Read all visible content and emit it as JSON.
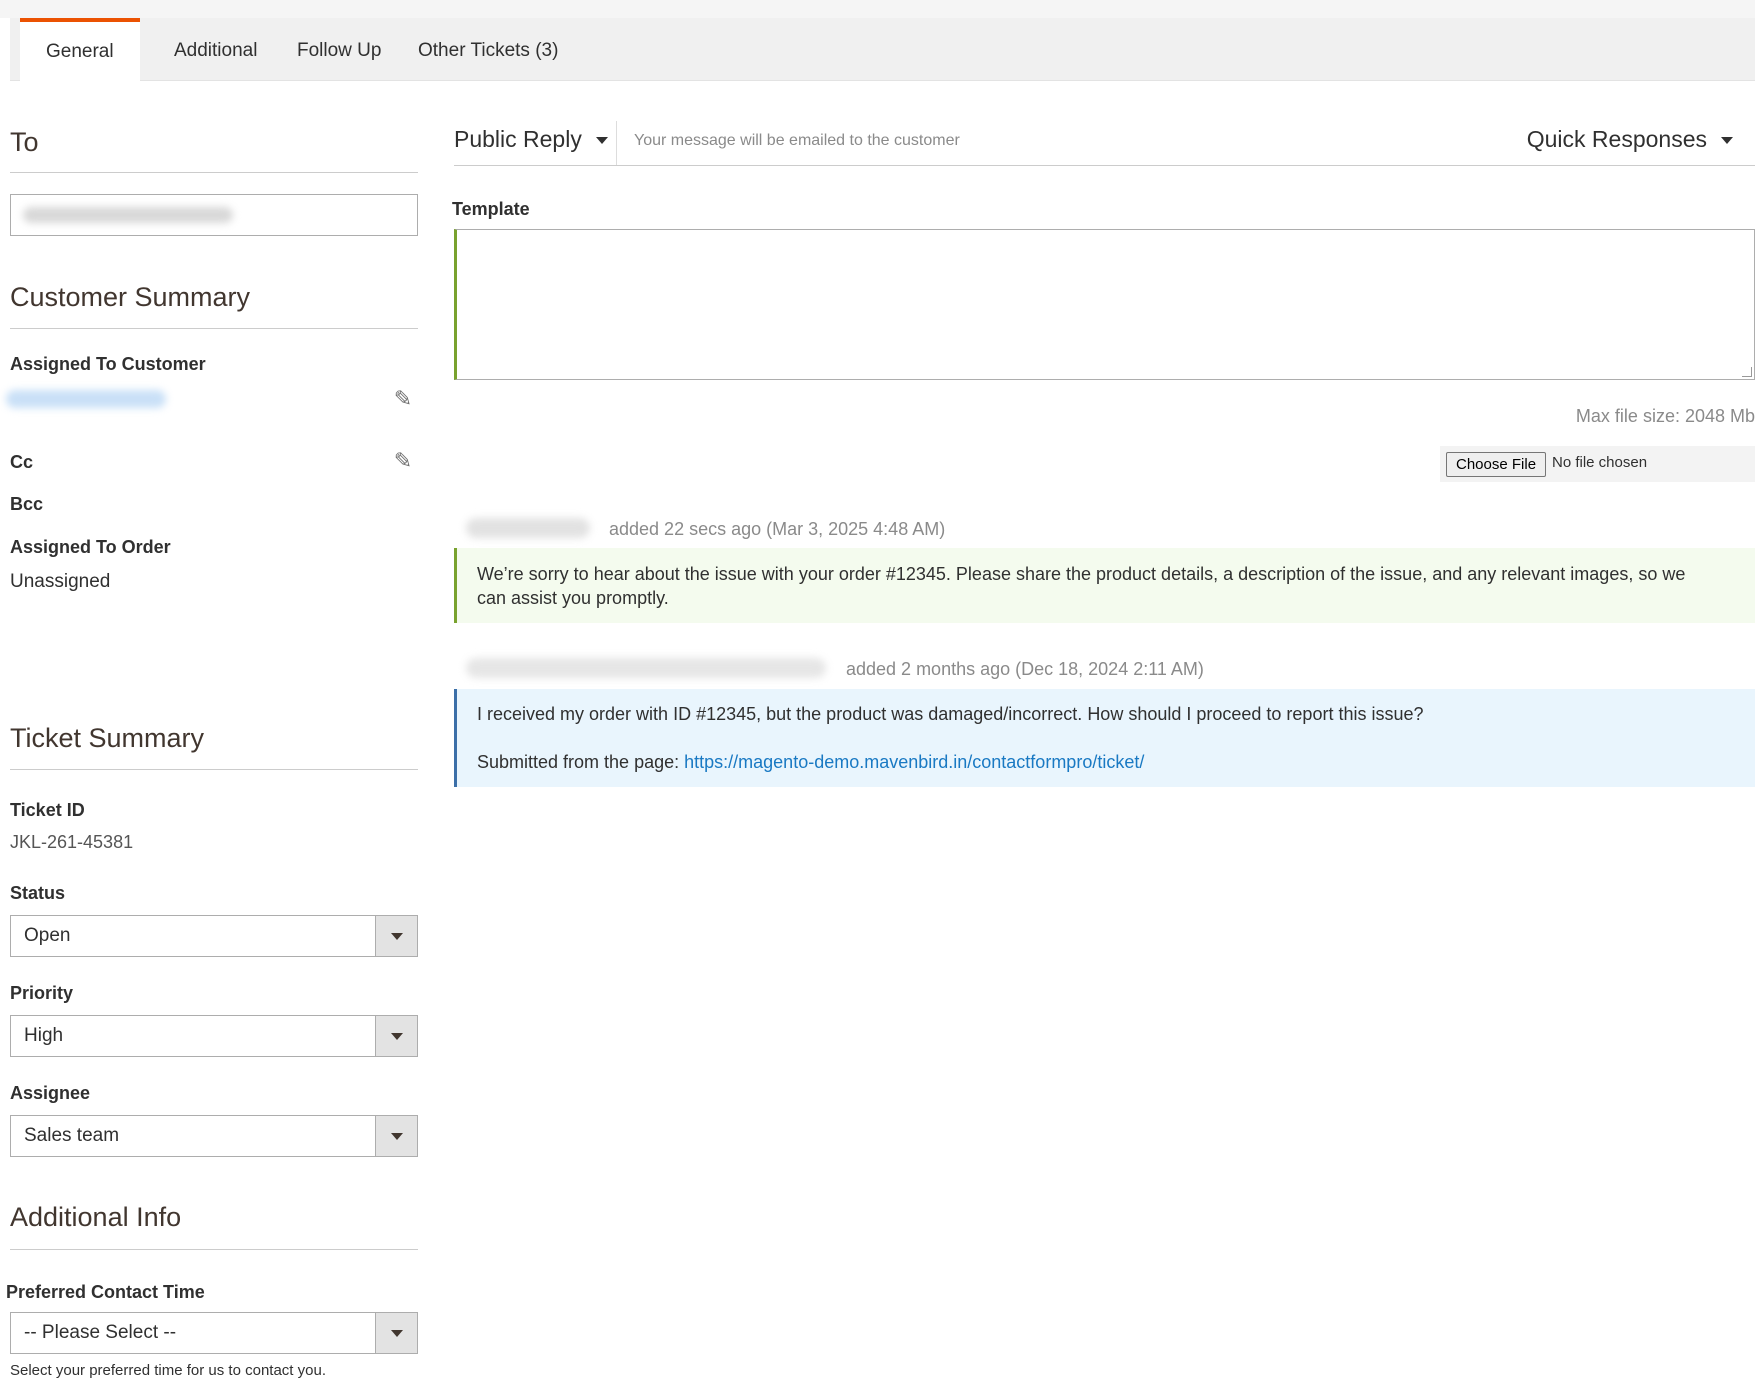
{
  "tabs": [
    {
      "label": "General",
      "active": true
    },
    {
      "label": "Additional",
      "active": false
    },
    {
      "label": "Follow Up",
      "active": false
    },
    {
      "label": "Other Tickets (3)",
      "active": false
    }
  ],
  "to": {
    "title": "To",
    "value": ""
  },
  "customer_summary": {
    "title": "Customer Summary",
    "assigned_to_customer_label": "Assigned To Customer",
    "cc_label": "Cc",
    "bcc_label": "Bcc",
    "assigned_to_order_label": "Assigned To Order",
    "assigned_to_order_value": "Unassigned"
  },
  "ticket_summary": {
    "title": "Ticket Summary",
    "ticket_id_label": "Ticket ID",
    "ticket_id": "JKL-261-45381",
    "status_label": "Status",
    "status_value": "Open",
    "priority_label": "Priority",
    "priority_value": "High",
    "assignee_label": "Assignee",
    "assignee_value": "Sales team"
  },
  "additional_info": {
    "title": "Additional Info",
    "preferred_contact_label": "Preferred Contact Time",
    "preferred_contact_value": "-- Please Select --",
    "preferred_contact_hint": "Select your preferred time for us to contact you."
  },
  "reply": {
    "type": "Public Reply",
    "note": "Your message will be emailed to the customer",
    "quick_responses": "Quick Responses",
    "template_label": "Template",
    "max_file_size": "Max file size: 2048 Mb",
    "choose_file": "Choose File",
    "file_status": "No file chosen"
  },
  "messages": [
    {
      "meta": "added 22 secs ago (Mar 3, 2025 4:48 AM)",
      "kind": "agent",
      "text": "We’re sorry to hear about the issue with your order #12345. Please share the product details, a description of the issue, and any relevant images, so we can assist you promptly."
    },
    {
      "meta": "added 2 months ago (Dec 18, 2024 2:11 AM)",
      "kind": "customer",
      "text": "I received my order with ID #12345, but the product was damaged/incorrect. How should I proceed to report this issue?",
      "submitted_prefix": "Submitted from the page: ",
      "submitted_url": "https://magento-demo.mavenbird.in/contactformpro/ticket/"
    }
  ],
  "colors": {
    "tab_accent": "#eb5202",
    "link": "#1979c3",
    "agent_border": "#79a22e",
    "agent_bg": "#f4fbee",
    "customer_border": "#3b6fa8",
    "customer_bg": "#e9f5fd"
  },
  "icons": {
    "edit": "pencil-icon",
    "dropdown": "caret-down-icon"
  }
}
